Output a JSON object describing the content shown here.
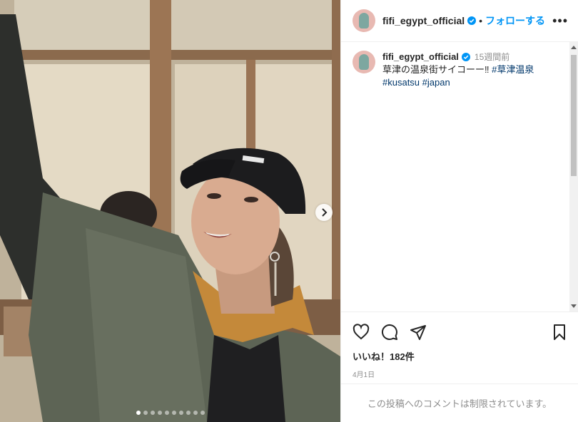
{
  "post": {
    "username": "fifi_egypt_official",
    "follow_label": "フォローする",
    "separator": "•",
    "more_label": "•••",
    "caption": {
      "username": "fifi_egypt_official",
      "time": "15週間前",
      "text": "草津の温泉街サイコーー‼︎ ",
      "hashtags": [
        "#草津温泉",
        "#kusatsu",
        "#japan"
      ]
    },
    "likes_label": "いいね！182件",
    "date": "4月1日",
    "comments_disabled": "この投稿へのコメントは制限されています。",
    "carousel": {
      "slide_count": 10,
      "active_index": 0
    }
  },
  "colors": {
    "accent": "#0095f6",
    "hashtag": "#00376b",
    "muted": "#8e8e8e",
    "verified": "#0095f6"
  },
  "icons": {
    "like": "heart-icon",
    "comment": "comment-icon",
    "share": "send-icon",
    "save": "bookmark-icon",
    "next": "chevron-right-icon",
    "verified": "verified-badge-icon"
  }
}
